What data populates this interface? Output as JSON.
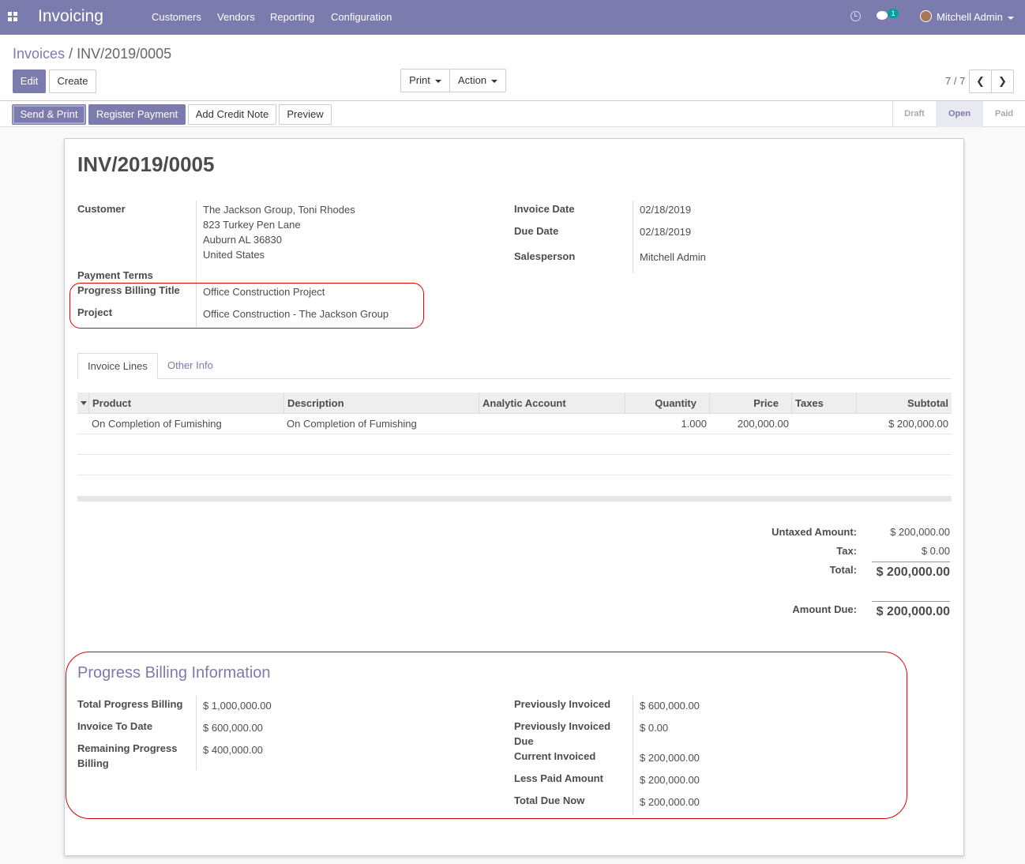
{
  "navbar": {
    "app_title": "Invoicing",
    "menu": [
      "Customers",
      "Vendors",
      "Reporting",
      "Configuration"
    ],
    "chat_count": "1",
    "user_name": "Mitchell Admin"
  },
  "breadcrumb": {
    "parent": "Invoices",
    "separator": "/",
    "current": "INV/2019/0005"
  },
  "buttons": {
    "edit": "Edit",
    "create": "Create",
    "print": "Print",
    "action": "Action"
  },
  "pager": "7 / 7",
  "header_buttons": {
    "send_print": "Send & Print",
    "register_payment": "Register Payment",
    "add_credit_note": "Add Credit Note",
    "preview": "Preview"
  },
  "stages": [
    "Draft",
    "Open",
    "Paid"
  ],
  "invoice": {
    "title": "INV/2019/0005",
    "labels": {
      "customer": "Customer",
      "payment_terms": "Payment Terms",
      "progress_billing_title": "Progress Billing Title",
      "project": "Project",
      "invoice_date": "Invoice Date",
      "due_date": "Due Date",
      "salesperson": "Salesperson"
    },
    "customer_lines": [
      "The Jackson Group, Toni Rhodes",
      "823 Turkey Pen Lane",
      "Auburn AL 36830",
      "United States"
    ],
    "progress_billing_title": "Office Construction Project",
    "project": "Office Construction - The Jackson Group",
    "invoice_date": "02/18/2019",
    "due_date": "02/18/2019",
    "salesperson": "Mitchell Admin"
  },
  "tabs": [
    "Invoice Lines",
    "Other Info"
  ],
  "lines": {
    "headers": [
      "Product",
      "Description",
      "Analytic Account",
      "Quantity",
      "Price",
      "Taxes",
      "Subtotal"
    ],
    "rows": [
      {
        "product": "On Completion of Fumishing",
        "description": "On Completion of Fumishing",
        "analytic": "",
        "quantity": "1.000",
        "price": "200,000.00",
        "taxes": "",
        "subtotal": "$ 200,000.00"
      }
    ]
  },
  "totals": {
    "untaxed_label": "Untaxed Amount:",
    "untaxed": "$ 200,000.00",
    "tax_label": "Tax:",
    "tax": "$ 0.00",
    "total_label": "Total:",
    "total": "$ 200,000.00",
    "amount_due_label": "Amount Due:",
    "amount_due": "$ 200,000.00"
  },
  "progress": {
    "heading": "Progress Billing Information",
    "total_progress_billing_label": "Total Progress Billing",
    "total_progress_billing": "$ 1,000,000.00",
    "invoice_to_date_label": "Invoice To Date",
    "invoice_to_date": "$ 600,000.00",
    "remaining_label": "Remaining Progress Billing",
    "remaining": "$ 400,000.00",
    "previously_invoiced_label": "Previously Invoiced",
    "previously_invoiced": "$ 600,000.00",
    "previously_invoiced_due_label": "Previously Invoiced Due",
    "previously_invoiced_due": "$ 0.00",
    "current_invoiced_label": "Current Invoiced",
    "current_invoiced": "$ 200,000.00",
    "less_paid_label": "Less Paid Amount",
    "less_paid": "$ 200,000.00",
    "total_due_now_label": "Total Due Now",
    "total_due_now": "$ 200,000.00"
  },
  "colors": {
    "brand": "#7c7bad",
    "highlight": "#dd0000"
  }
}
